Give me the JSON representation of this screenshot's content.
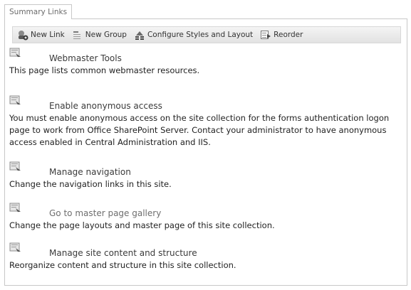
{
  "tab": {
    "label": "Summary Links"
  },
  "toolbar": {
    "new_link": "New Link",
    "new_group": "New Group",
    "configure": "Configure Styles and Layout",
    "reorder": "Reorder"
  },
  "links": [
    {
      "title": "Webmaster Tools",
      "description": "This page lists common webmaster resources."
    },
    {
      "title": "Enable anonymous access",
      "description": "You must enable anonymous access on the site collection for the forms authentication logon page to work from Office SharePoint Server. Contact your administrator to have anonymous access enabled in Central Administration and IIS."
    },
    {
      "title": "Manage navigation",
      "description": "Change the navigation links in this site."
    },
    {
      "title": "Go to master page gallery",
      "description": "Change the page layouts and master page of this site collection."
    },
    {
      "title": "Manage site content and structure",
      "description": "Reorganize content and structure in this site collection."
    }
  ]
}
